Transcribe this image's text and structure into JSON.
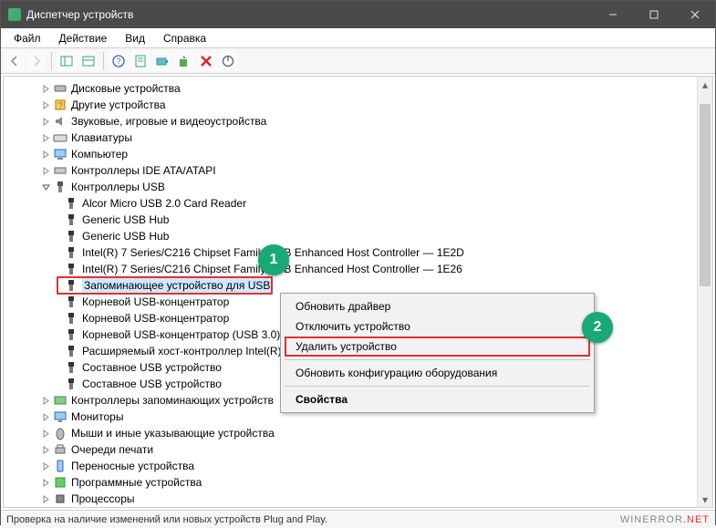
{
  "window": {
    "title": "Диспетчер устройств"
  },
  "menu": {
    "file": "Файл",
    "action": "Действие",
    "view": "Вид",
    "help": "Справка"
  },
  "tree": {
    "disk_drives": "Дисковые устройства",
    "other_devices": "Другие устройства",
    "sound_video": "Звуковые, игровые и видеоустройства",
    "keyboards": "Клавиатуры",
    "computer": "Компьютер",
    "ide_ata": "Контроллеры IDE ATA/ATAPI",
    "usb_controllers": "Контроллеры USB",
    "usb": {
      "alcor": "Alcor Micro USB 2.0 Card Reader",
      "generic_hub_1": "Generic USB Hub",
      "generic_hub_2": "Generic USB Hub",
      "intel_1e2d": "Intel(R) 7 Series/C216 Chipset Family USB Enhanced Host Controller — 1E2D",
      "intel_1e26": "Intel(R) 7 Series/C216 Chipset Family USB Enhanced Host Controller — 1E26",
      "usb_storage": "Запоминающее устройство для USB",
      "root_hub_1": "Корневой USB-концентратор",
      "root_hub_2": "Корневой USB-концентратор",
      "root_hub_usb3": "Корневой USB-концентратор (USB 3.0)",
      "ext_host": "Расширяемый хост-контроллер Intel(R) USB 3.0",
      "composite_1": "Составное USB устройство",
      "composite_2": "Составное USB устройство"
    },
    "storage_controllers": "Контроллеры запоминающих устройств",
    "monitors": "Мониторы",
    "mice": "Мыши и иные указывающие устройства",
    "print_queues": "Очереди печати",
    "portable": "Переносные устройства",
    "software_devices": "Программные устройства",
    "processors": "Процессоры"
  },
  "context_menu": {
    "update_driver": "Обновить драйвер",
    "disable": "Отключить устройство",
    "uninstall": "Удалить устройство",
    "scan_hw": "Обновить конфигурацию оборудования",
    "properties": "Свойства"
  },
  "badges": {
    "one": "1",
    "two": "2"
  },
  "status": "Проверка на наличие изменений или новых устройств Plug and Play.",
  "watermark": {
    "a": "WINERROR",
    "b": ".NET"
  }
}
